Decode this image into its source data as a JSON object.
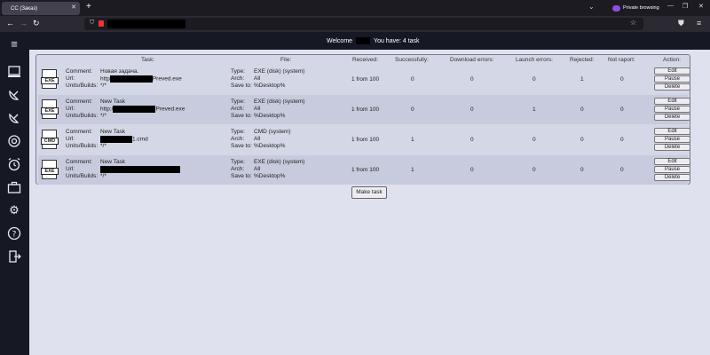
{
  "browser": {
    "tab_title": "CC (Заказ)",
    "private_label": "Private browsing"
  },
  "topbar": {
    "welcome": "Welcome",
    "you_have": "You have: 4 task"
  },
  "table": {
    "headers": [
      "Task:",
      "File:",
      "Received:",
      "Successfully:",
      "Download errors:",
      "Launch errors:",
      "Rejected:",
      "Not raport:",
      "Action:"
    ],
    "labels": {
      "comment": "Comment:",
      "url": "Url:",
      "units": "Units/Builds:",
      "type": "Type:",
      "arch": "Arch:",
      "save": "Save to:"
    },
    "rows": [
      {
        "icon": "EXE",
        "comment": "Новая задача.",
        "url_prefix": "http",
        "url_suffix": "Preved.exe",
        "units": "*/*",
        "type": "EXE (disk) (system)",
        "arch": "All",
        "save": "%Desktop%",
        "received": "1 from 100",
        "successfully": "0",
        "download_errors": "0",
        "launch_errors": "0",
        "rejected": "1",
        "not_raport": "0"
      },
      {
        "icon": "EXE",
        "comment": "New Task",
        "url_prefix": "http",
        "url_suffix": "Preved.exe",
        "units": "*/*",
        "type": "EXE (disk) (system)",
        "arch": "All",
        "save": "%Desktop%",
        "received": "1 from 100",
        "successfully": "0",
        "download_errors": "0",
        "launch_errors": "1",
        "rejected": "0",
        "not_raport": "0"
      },
      {
        "icon": "CMD",
        "comment": "New Task",
        "url_prefix": "",
        "url_suffix": "1.cmd",
        "units": "*/*",
        "type": "CMD (system)",
        "arch": "All",
        "save": "%Desktop%",
        "received": "1 from 100",
        "successfully": "1",
        "download_errors": "0",
        "launch_errors": "0",
        "rejected": "0",
        "not_raport": "0"
      },
      {
        "icon": "EXE",
        "comment": "New Task",
        "url_prefix": "",
        "url_suffix": "",
        "units": "*/*",
        "type": "EXE (disk) (system)",
        "arch": "All",
        "save": "%Desktop%",
        "received": "1 from 100",
        "successfully": "1",
        "download_errors": "0",
        "launch_errors": "0",
        "rejected": "0",
        "not_raport": "0"
      }
    ],
    "actions": {
      "edit": "Edit",
      "pause": "Pause",
      "delete": "Delete"
    }
  },
  "make_task": "Make task",
  "sidebar_icons": [
    "menu-icon",
    "computer-icon",
    "satellite-dish-icon",
    "satellite-dish-icon",
    "target-icon",
    "alarm-icon",
    "briefcase-icon",
    "gear-icon",
    "help-icon",
    "logout-icon"
  ]
}
